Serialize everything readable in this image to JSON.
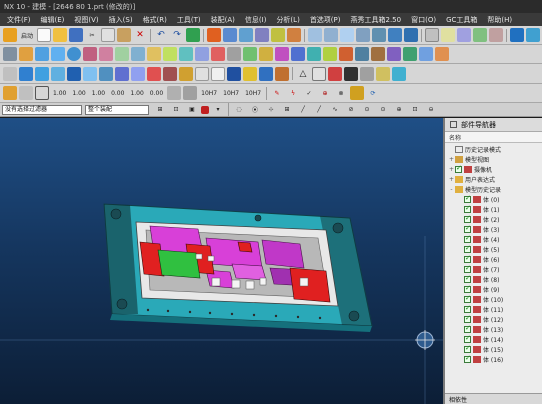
{
  "window": {
    "title": "NX 10 - 建模 - [2646 80 1.prt (修改的)]"
  },
  "menu": {
    "items": [
      "文件(F)",
      "编辑(E)",
      "视图(V)",
      "插入(S)",
      "格式(R)",
      "工具(T)",
      "装配(A)",
      "信息(I)",
      "分析(L)",
      "首选项(P)",
      "燕秀工具箱2.50",
      "窗口(O)",
      "GC工具箱",
      "帮助(H)"
    ]
  },
  "toolbar": {
    "start_label": "启动",
    "num_buttons": [
      "1.00",
      "1.00",
      "1.00",
      "0.00",
      "1.00",
      "0.00"
    ],
    "num_subs": [
      "1.00",
      "1.00",
      "1.00",
      "0.00",
      "1.00",
      "0.00"
    ],
    "flag_buttons": [
      "10H7",
      "10H7",
      "10H7"
    ]
  },
  "filter": {
    "type_filter": "没有选择过滤器",
    "scope": "整个装配"
  },
  "navigator": {
    "title": "部件导航器",
    "column_name": "名称",
    "items": [
      {
        "label": "历史记录模式",
        "expand": ""
      },
      {
        "label": "模型视图",
        "expand": "+"
      },
      {
        "label": "摄像机",
        "expand": "+"
      },
      {
        "label": "用户表达式",
        "expand": "+"
      },
      {
        "label": "模型历史记录",
        "expand": "-"
      },
      {
        "label": "体 (0)",
        "expand": ""
      },
      {
        "label": "体 (1)",
        "expand": ""
      },
      {
        "label": "体 (2)",
        "expand": ""
      },
      {
        "label": "体 (3)",
        "expand": ""
      },
      {
        "label": "体 (4)",
        "expand": ""
      },
      {
        "label": "体 (5)",
        "expand": ""
      },
      {
        "label": "体 (6)",
        "expand": ""
      },
      {
        "label": "体 (7)",
        "expand": ""
      },
      {
        "label": "体 (8)",
        "expand": ""
      },
      {
        "label": "体 (9)",
        "expand": ""
      },
      {
        "label": "体 (10)",
        "expand": ""
      },
      {
        "label": "体 (11)",
        "expand": ""
      },
      {
        "label": "体 (12)",
        "expand": ""
      },
      {
        "label": "体 (13)",
        "expand": ""
      },
      {
        "label": "体 (14)",
        "expand": ""
      },
      {
        "label": "体 (15)",
        "expand": ""
      },
      {
        "label": "体 (16)",
        "expand": ""
      }
    ],
    "footer": "相依性"
  },
  "colors": {
    "viewport_top": "#1f4f86",
    "mold_base": "#2aa9b8",
    "insert_magenta": "#d840d8",
    "insert_red": "#e02020",
    "insert_green": "#30c040"
  }
}
